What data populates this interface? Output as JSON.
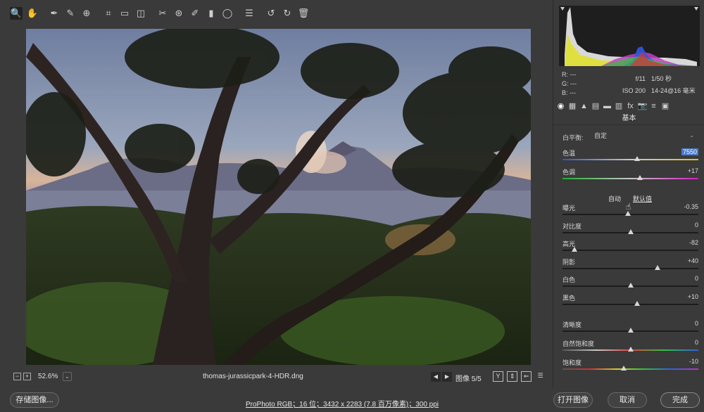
{
  "toolbar": {
    "tools": [
      {
        "icon": "zoom-icon",
        "glyph": "🔍"
      },
      {
        "icon": "hand-icon",
        "glyph": "✋"
      },
      {
        "icon": "white-balance-eyedropper-icon",
        "glyph": "✒"
      },
      {
        "icon": "color-sampler-icon",
        "glyph": "✎"
      },
      {
        "icon": "targeted-adjustment-icon",
        "glyph": "⊕"
      },
      {
        "icon": "crop-icon",
        "glyph": "⌗"
      },
      {
        "icon": "straighten-icon",
        "glyph": "▭"
      },
      {
        "icon": "transform-icon",
        "glyph": "◫"
      },
      {
        "icon": "spot-removal-icon",
        "glyph": "✂"
      },
      {
        "icon": "red-eye-icon",
        "glyph": "⊛"
      },
      {
        "icon": "adjustment-brush-icon",
        "glyph": "✐"
      },
      {
        "icon": "graduated-filter-icon",
        "glyph": "▮"
      },
      {
        "icon": "radial-filter-icon",
        "glyph": "◯"
      },
      {
        "icon": "preferences-icon",
        "glyph": "☰"
      },
      {
        "icon": "rotate-left-icon",
        "glyph": "↺"
      },
      {
        "icon": "rotate-right-icon",
        "glyph": "↻"
      },
      {
        "icon": "trash-icon",
        "glyph": "🗑"
      }
    ],
    "exit_icon": "⇥"
  },
  "status": {
    "zoom_minus": "−",
    "zoom_plus": "+",
    "zoom_level": "52.6%",
    "zoom_dropdown": "⌄",
    "filename": "thomas-jurassicpark-4-HDR.dng",
    "prev": "◀",
    "next": "▶",
    "image_counter": "图像 5/5",
    "icon_y": "Y",
    "icon_compare": "⇕",
    "icon_swap": "⇐",
    "icon_settings": "☰"
  },
  "bottom": {
    "save_label": "存储图像...",
    "workflow_options": "ProPhoto RGB；16 位；3432 x 2283 (7.8 百万像素)；300 ppi",
    "open_label": "打开图像",
    "cancel_label": "取消",
    "done_label": "完成"
  },
  "rpanel": {
    "rgb": {
      "r": "R:  ---",
      "g": "G:  ---",
      "b": "B:  ---"
    },
    "camera": {
      "aperture": "f/11",
      "shutter": "1/50 秒",
      "iso": "ISO 200",
      "lens": "14-24@16 毫米"
    },
    "section_title": "基本",
    "wb_label": "白平衡:",
    "wb_value": "自定",
    "auto_label": "自动",
    "default_label": "默认值",
    "sliders": [
      {
        "label": "色温",
        "value": "7550",
        "fraction": 0.55,
        "selected": true,
        "gradient": "linear-gradient(90deg,#2d55c8,#c8c8c8,#e0c020)"
      },
      {
        "label": "色调",
        "value": "+17",
        "fraction": 0.57,
        "selected": false,
        "gradient": "linear-gradient(90deg,#20b030,#c8c8c8,#d020c0)"
      },
      {
        "label": "曝光",
        "value": "-0.35",
        "fraction": 0.48,
        "selected": false,
        "gradient": ""
      },
      {
        "label": "对比度",
        "value": "0",
        "fraction": 0.5,
        "selected": false,
        "gradient": ""
      },
      {
        "label": "高光",
        "value": "-82",
        "fraction": 0.09,
        "selected": false,
        "gradient": ""
      },
      {
        "label": "阴影",
        "value": "+40",
        "fraction": 0.7,
        "selected": false,
        "gradient": ""
      },
      {
        "label": "白色",
        "value": "0",
        "fraction": 0.5,
        "selected": false,
        "gradient": ""
      },
      {
        "label": "黑色",
        "value": "+10",
        "fraction": 0.55,
        "selected": false,
        "gradient": ""
      },
      {
        "label": "清晰度",
        "value": "0",
        "fraction": 0.5,
        "selected": false,
        "gradient": ""
      },
      {
        "label": "自然饱和度",
        "value": "0",
        "fraction": 0.5,
        "selected": false,
        "gradient": "linear-gradient(90deg,#555,#c8c8c8,#e04040,#30c040,#3060e0)"
      },
      {
        "label": "饱和度",
        "value": "-10",
        "fraction": 0.45,
        "selected": false,
        "gradient": "linear-gradient(90deg,#555,#d03030,#d0d030,#30c040,#3060e0,#c030c0)"
      }
    ],
    "panel_tabs": [
      {
        "icon": "basic-icon",
        "glyph": "◉"
      },
      {
        "icon": "tone-curve-icon",
        "glyph": "▦"
      },
      {
        "icon": "detail-icon",
        "glyph": "▲"
      },
      {
        "icon": "hsl-icon",
        "glyph": "▤"
      },
      {
        "icon": "split-toning-icon",
        "glyph": "▬"
      },
      {
        "icon": "lens-corrections-icon",
        "glyph": "▥"
      },
      {
        "icon": "effects-icon",
        "glyph": "fx"
      },
      {
        "icon": "camera-calibration-icon",
        "glyph": "📷"
      },
      {
        "icon": "presets-icon",
        "glyph": "≡"
      },
      {
        "icon": "snapshots-icon",
        "glyph": "▣"
      }
    ]
  }
}
